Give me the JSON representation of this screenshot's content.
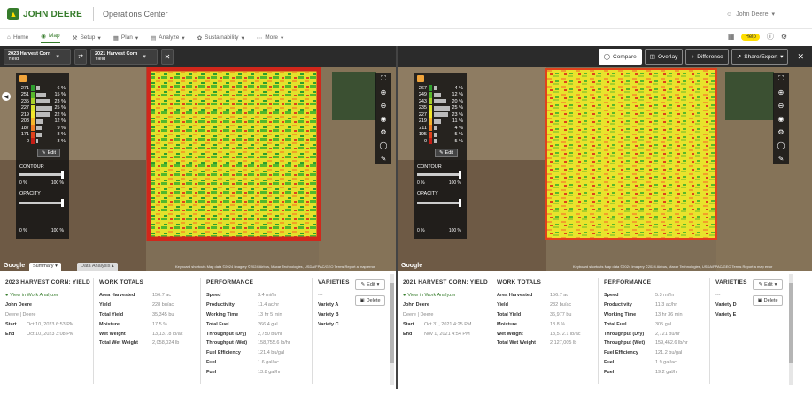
{
  "header": {
    "brand": "JOHN DEERE",
    "app_name": "Operations Center",
    "user_name": "John Deere",
    "help_label": "Help"
  },
  "nav": {
    "items": [
      {
        "label": "Home",
        "icon": "home-icon"
      },
      {
        "label": "Map",
        "icon": "person-pin-icon"
      },
      {
        "label": "Setup",
        "icon": "wrench-icon"
      },
      {
        "label": "Plan",
        "icon": "grid-icon"
      },
      {
        "label": "Analyze",
        "icon": "chart-icon"
      },
      {
        "label": "Sustainability",
        "icon": "leaf-icon"
      },
      {
        "label": "More",
        "icon": "dots-icon"
      }
    ]
  },
  "toolbar": {
    "left_layer": {
      "line1": "2023 Harvest Corn",
      "line2": "Yield"
    },
    "right_layer": {
      "line1": "2021 Harvest Corn",
      "line2": "Yield"
    },
    "compare_label": "Compare",
    "overlay_label": "Overlay",
    "difference_label": "Difference",
    "share_label": "Share/Export",
    "colors": {
      "bar": "#2b2b2b",
      "brand": "#367c2b",
      "accent": "#ffde00"
    }
  },
  "left": {
    "legend": {
      "rows": [
        {
          "value": "271",
          "pct": "6 %",
          "share": 0.06,
          "color": "#2e9e2e"
        },
        {
          "value": "251",
          "pct": "15 %",
          "share": 0.15,
          "color": "#58b82c"
        },
        {
          "value": "235",
          "pct": "23 %",
          "share": 0.23,
          "color": "#a8d02a"
        },
        {
          "value": "227",
          "pct": "25 %",
          "share": 0.25,
          "color": "#d9e22a"
        },
        {
          "value": "219",
          "pct": "22 %",
          "share": 0.22,
          "color": "#f2e52c"
        },
        {
          "value": "203",
          "pct": "12 %",
          "share": 0.12,
          "color": "#f5b52a"
        },
        {
          "value": "187",
          "pct": "9 %",
          "share": 0.09,
          "color": "#ef7a22"
        },
        {
          "value": "171",
          "pct": "8 %",
          "share": 0.08,
          "color": "#e0421c"
        },
        {
          "value": "0",
          "pct": "3 %",
          "share": 0.03,
          "color": "#c41e16"
        }
      ],
      "edit_label": "Edit",
      "contour_label": "CONTOUR",
      "contour_min": "0 %",
      "contour_max": "100 %",
      "opacity_label": "OPACITY",
      "opacity_min": "0 %",
      "opacity_max": "100 %"
    },
    "map_footer": "Google",
    "attribution": "Keyboard shortcuts   Map data ©2024 Imagery ©2024 Airbus, Maxar Technologies, USDA/FPAC/GEO   Terms   Report a map error",
    "tabs": [
      "Summary",
      "Data Analysis"
    ],
    "summary": {
      "title": "2023 HARVEST CORN: YIELD",
      "view_link": "View in Work Analyzer",
      "operator": "John Deere",
      "org": "Deere  |  Deere",
      "start_label": "Start",
      "start_value": "Oct 10, 2023 6:53 PM",
      "end_label": "End",
      "end_value": "Oct 10, 2023 3:08 PM"
    },
    "work_totals": {
      "title": "WORK TOTALS",
      "rows": [
        {
          "k": "Area Harvested",
          "v": "156.7 ac"
        },
        {
          "k": "Yield",
          "v": "228 bu/ac"
        },
        {
          "k": "Total Yield",
          "v": "35,345 bu"
        },
        {
          "k": "Moisture",
          "v": "17.5 %"
        },
        {
          "k": "Wet Weight",
          "v": "13,137.8 lb/ac"
        },
        {
          "k": "Total Wet Weight",
          "v": "2,058,024 lb"
        }
      ]
    },
    "performance": {
      "title": "PERFORMANCE",
      "rows": [
        {
          "k": "Speed",
          "v": "3.4 mi/hr"
        },
        {
          "k": "Productivity",
          "v": "11.4 ac/hr"
        },
        {
          "k": "Working Time",
          "v": "13 hr 5 min"
        },
        {
          "k": "Total Fuel",
          "v": "266.4 gal"
        },
        {
          "k": "Throughput (Dry)",
          "v": "2,750 bu/hr"
        },
        {
          "k": "Throughput (Wet)",
          "v": "158,755.6 lb/hr"
        },
        {
          "k": "Fuel Efficiency",
          "v": "121.4 bu/gal"
        },
        {
          "k": "Fuel",
          "v": "1.6 gal/ac"
        },
        {
          "k": "Fuel",
          "v": "13.8 gal/hr"
        }
      ]
    },
    "varieties": {
      "title": "VARIETIES",
      "dash": "---",
      "items": [
        "Variety A",
        "Variety B",
        "Variety C"
      ]
    },
    "edit_btn": "Edit",
    "delete_btn": "Delete"
  },
  "right": {
    "legend": {
      "rows": [
        {
          "value": "267",
          "pct": "4 %",
          "share": 0.04,
          "color": "#2e9e2e"
        },
        {
          "value": "249",
          "pct": "12 %",
          "share": 0.12,
          "color": "#58b82c"
        },
        {
          "value": "243",
          "pct": "20 %",
          "share": 0.2,
          "color": "#a8d02a"
        },
        {
          "value": "235",
          "pct": "25 %",
          "share": 0.25,
          "color": "#d9e22a"
        },
        {
          "value": "227",
          "pct": "23 %",
          "share": 0.23,
          "color": "#f2e52c"
        },
        {
          "value": "219",
          "pct": "11 %",
          "share": 0.11,
          "color": "#f5b52a"
        },
        {
          "value": "211",
          "pct": "4 %",
          "share": 0.04,
          "color": "#ef7a22"
        },
        {
          "value": "195",
          "pct": "5 %",
          "share": 0.05,
          "color": "#e0421c"
        },
        {
          "value": "0",
          "pct": "5 %",
          "share": 0.05,
          "color": "#c41e16"
        }
      ],
      "edit_label": "Edit",
      "contour_label": "CONTOUR",
      "contour_min": "0 %",
      "contour_max": "100 %",
      "opacity_label": "OPACITY",
      "opacity_min": "0 %",
      "opacity_max": "100 %"
    },
    "map_footer": "Google",
    "attribution": "Keyboard shortcuts   Map data ©2024 Imagery ©2024 Airbus, Maxar Technologies, USDA/FPAC/GEO   Terms   Report a map error",
    "summary": {
      "title": "2021 HARVEST CORN: YIELD",
      "view_link": "View in Work Analyzer",
      "operator": "John Deere",
      "org": "Deere  |  Deere",
      "start_label": "Start",
      "start_value": "Oct 31, 2021 4:25 PM",
      "end_label": "End",
      "end_value": "Nov 1, 2021 4:54 PM"
    },
    "work_totals": {
      "title": "WORK TOTALS",
      "rows": [
        {
          "k": "Area Harvested",
          "v": "156.7 ac"
        },
        {
          "k": "Yield",
          "v": "232 bu/ac"
        },
        {
          "k": "Total Yield",
          "v": "36,977 bu"
        },
        {
          "k": "Moisture",
          "v": "18.8 %"
        },
        {
          "k": "Wet Weight",
          "v": "13,572.1 lb/ac"
        },
        {
          "k": "Total Wet Weight",
          "v": "2,127,005 lb"
        }
      ]
    },
    "performance": {
      "title": "PERFORMANCE",
      "rows": [
        {
          "k": "Speed",
          "v": "5.3 mi/hr"
        },
        {
          "k": "Productivity",
          "v": "11.3 ac/hr"
        },
        {
          "k": "Working Time",
          "v": "13 hr 36 min"
        },
        {
          "k": "Total Fuel",
          "v": "305 gal"
        },
        {
          "k": "Throughput (Dry)",
          "v": "2,721 bu/hr"
        },
        {
          "k": "Throughput (Wet)",
          "v": "159,462.6 lb/hr"
        },
        {
          "k": "Fuel Efficiency",
          "v": "121.2 bu/gal"
        },
        {
          "k": "Fuel",
          "v": "1.9 gal/ac"
        },
        {
          "k": "Fuel",
          "v": "19.2 gal/hr"
        }
      ]
    },
    "varieties": {
      "title": "VARIETIES",
      "dash": "---",
      "items": [
        "Variety D",
        "Variety E"
      ]
    },
    "edit_btn": "Edit",
    "delete_btn": "Delete"
  }
}
